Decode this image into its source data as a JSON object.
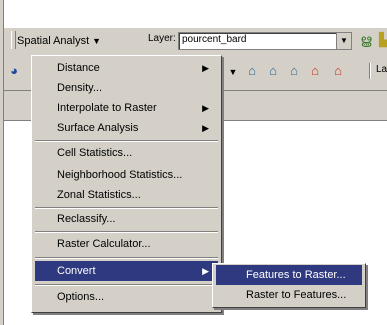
{
  "toolbar": {
    "spatial_analyst_menu": "Spatial Analyst",
    "layer_label": "Layer:",
    "layer_value": "pourcent_bard",
    "lay_partial": "Lay"
  },
  "menu": {
    "items": [
      {
        "label": "Distance",
        "submenu": true
      },
      {
        "label": "Density...",
        "submenu": false
      },
      {
        "label": "Interpolate to Raster",
        "submenu": true
      },
      {
        "label": "Surface Analysis",
        "submenu": true
      },
      {
        "label": "Cell Statistics...",
        "submenu": false
      },
      {
        "label": "Neighborhood Statistics...",
        "submenu": false
      },
      {
        "label": "Zonal Statistics...",
        "submenu": false
      },
      {
        "label": "Reclassify...",
        "submenu": false
      },
      {
        "label": "Raster Calculator...",
        "submenu": false
      },
      {
        "label": "Convert",
        "submenu": true,
        "highlighted": true
      },
      {
        "label": "Options...",
        "submenu": false
      }
    ]
  },
  "submenu": {
    "items": [
      {
        "label": "Features to Raster...",
        "highlighted": true
      },
      {
        "label": "Raster to Features...",
        "highlighted": false
      }
    ]
  },
  "colors": {
    "menu_bg": "#d4d0c8",
    "highlight": "#2f3980"
  }
}
